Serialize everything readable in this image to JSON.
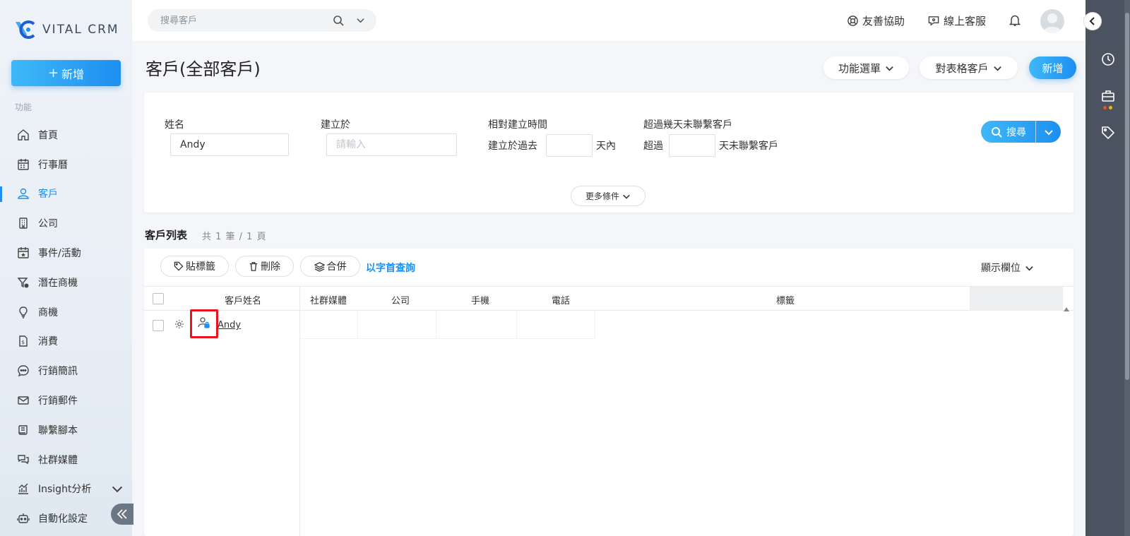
{
  "brand": {
    "name": "VITAL CRM"
  },
  "sidebar": {
    "new_label": "新增",
    "section_label": "功能",
    "items": [
      {
        "label": "首頁",
        "icon": "home-icon"
      },
      {
        "label": "行事曆",
        "icon": "calendar-icon"
      },
      {
        "label": "客戶",
        "icon": "user-icon",
        "active": true
      },
      {
        "label": "公司",
        "icon": "building-icon"
      },
      {
        "label": "事件/活動",
        "icon": "event-icon"
      },
      {
        "label": "潛在商機",
        "icon": "funnel-icon"
      },
      {
        "label": "商機",
        "icon": "lightbulb-icon"
      },
      {
        "label": "消費",
        "icon": "receipt-icon"
      },
      {
        "label": "行銷簡訊",
        "icon": "sms-icon"
      },
      {
        "label": "行銷郵件",
        "icon": "mail-icon"
      },
      {
        "label": "聯繫腳本",
        "icon": "script-icon"
      },
      {
        "label": "社群媒體",
        "icon": "chat-icon"
      },
      {
        "label": "Insight分析",
        "icon": "chart-icon"
      },
      {
        "label": "自動化設定",
        "icon": "robot-icon"
      }
    ]
  },
  "topbar": {
    "search_placeholder": "搜尋客戶",
    "help_label": "友善協助",
    "support_label": "線上客服"
  },
  "header": {
    "title": "客戶(全部客戶)",
    "menu_label": "功能選單",
    "table_label": "對表格客戶",
    "new_label": "新增"
  },
  "filters": {
    "name_label": "姓名",
    "name_value": "Andy",
    "created_label": "建立於",
    "created_placeholder": "請輸入",
    "relative_label": "相對建立時間",
    "relative_prefix": "建立於過去",
    "relative_suffix": "天內",
    "uncontacted_label": "超過幾天未聯繫客戶",
    "uncontacted_prefix": "超過",
    "uncontacted_suffix": "天未聯繫客戶",
    "search_label": "搜尋",
    "more_label": "更多條件"
  },
  "list": {
    "title": "客戶列表",
    "count": "共 1 筆 / 1 頁",
    "tag_label": "貼標籤",
    "delete_label": "刪除",
    "merge_label": "合併",
    "alpha_label": "以字首查詢",
    "columns_label": "顯示欄位",
    "headers": {
      "name": "客戶姓名",
      "social": "社群媒體",
      "company": "公司",
      "mobile": "手機",
      "phone": "電話",
      "tags": "標籤"
    },
    "rows": [
      {
        "name": "Andy"
      }
    ]
  },
  "colors": {
    "accent": "#1d8ff0",
    "highlight": "#e8141e",
    "rail": "#4b5260"
  }
}
